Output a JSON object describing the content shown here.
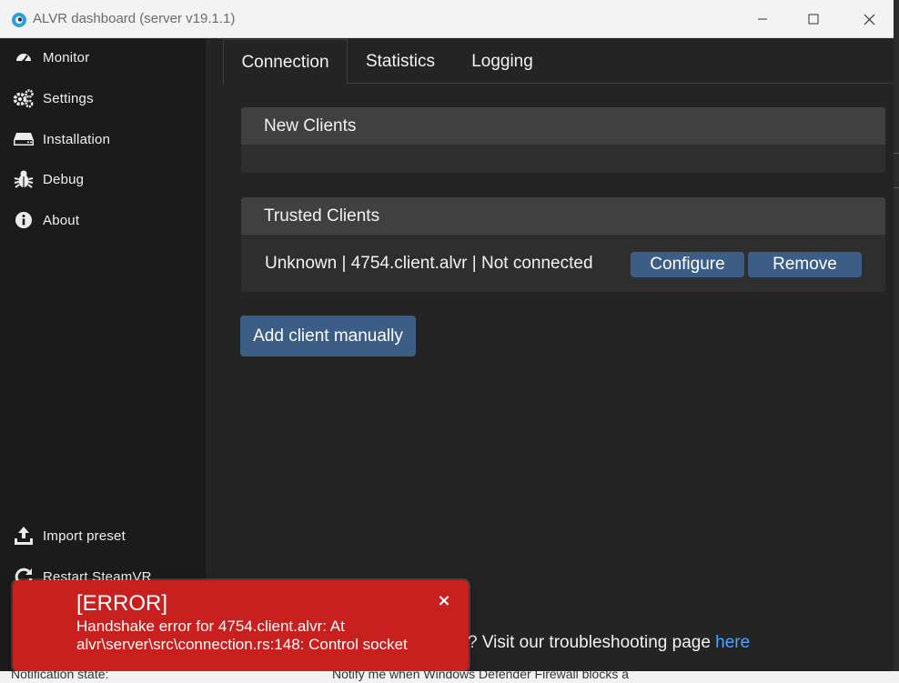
{
  "window": {
    "title": "ALVR dashboard (server v19.1.1)"
  },
  "sidebar": {
    "items": [
      {
        "label": "Monitor",
        "icon": "gauge-icon"
      },
      {
        "label": "Settings",
        "icon": "gears-icon"
      },
      {
        "label": "Installation",
        "icon": "hdd-icon"
      },
      {
        "label": "Debug",
        "icon": "bug-icon"
      },
      {
        "label": "About",
        "icon": "info-icon"
      }
    ],
    "bottom_items": [
      {
        "label": "Import preset",
        "icon": "upload-icon"
      },
      {
        "label": "Restart SteamVR",
        "icon": "refresh-icon"
      }
    ]
  },
  "tabs": [
    {
      "label": "Connection",
      "active": true
    },
    {
      "label": "Statistics",
      "active": false
    },
    {
      "label": "Logging",
      "active": false
    }
  ],
  "new_clients": {
    "title": "New Clients"
  },
  "trusted_clients": {
    "title": "Trusted Clients",
    "clients": [
      {
        "text": "Unknown | 4754.client.alvr | Not connected",
        "configure_label": "Configure",
        "remove_label": "Remove"
      }
    ]
  },
  "add_client_label": "Add client manually",
  "footer": {
    "text": "? Visit our troubleshooting page ",
    "link": "here"
  },
  "toast": {
    "title": "[ERROR]",
    "message": "Handshake error for 4754.client.alvr: At alvr\\server\\src\\connection.rs:148: Control socket",
    "close_glyph": "×"
  },
  "background_window": {
    "left_text": "Notification state:",
    "right_text": "Notify me when Windows Defender Firewall blocks a"
  },
  "colors": {
    "button": "#3c5d85",
    "toast": "#c81f1f",
    "link": "#4da3ff",
    "panel_header": "#404040"
  }
}
